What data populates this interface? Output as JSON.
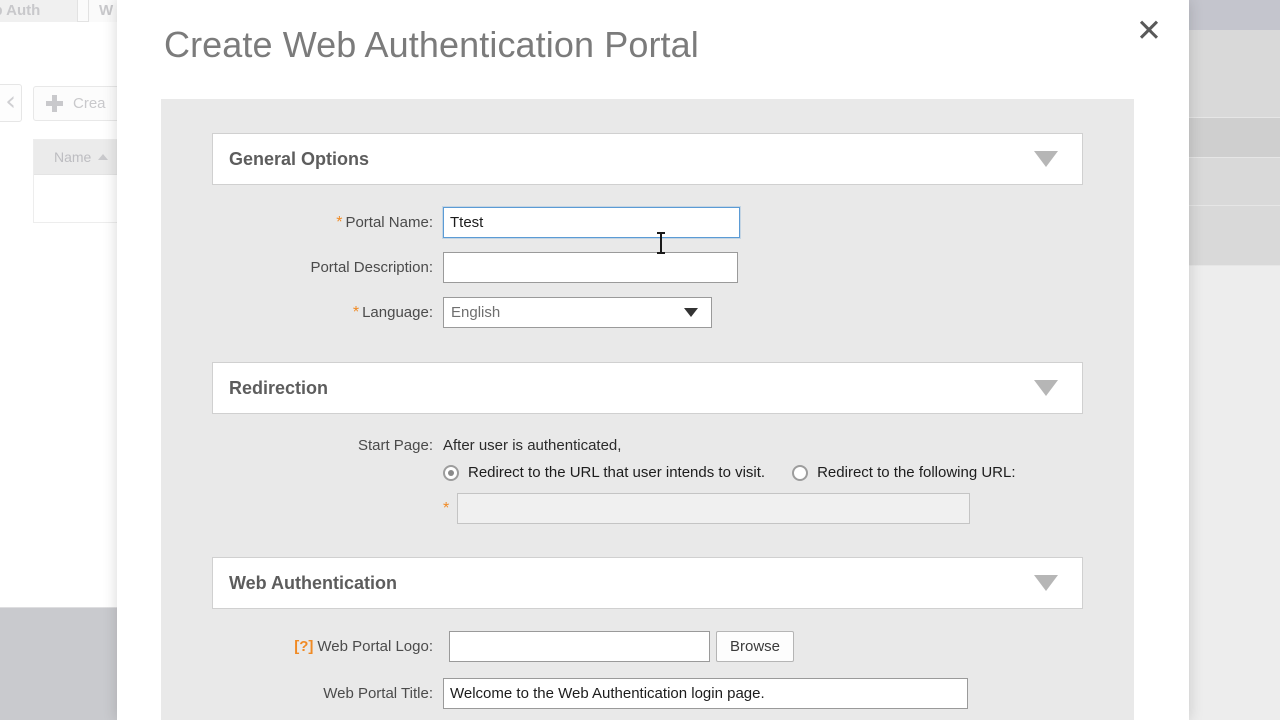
{
  "background": {
    "tabs": [
      {
        "label": "eb Auth"
      },
      {
        "label": "W"
      }
    ],
    "back_chevron": "‹",
    "create_button": {
      "label": "Crea",
      "icon": "plus-icon"
    },
    "table": {
      "columns": [
        "Name"
      ]
    }
  },
  "modal": {
    "title": "Create Web Authentication Portal",
    "close_label": "✕",
    "sections": [
      {
        "id": "general_options",
        "title": "General Options",
        "caret": "chevron-down-icon"
      },
      {
        "id": "redirection",
        "title": "Redirection",
        "caret": "chevron-down-icon"
      },
      {
        "id": "web_authentication",
        "title": "Web Authentication",
        "caret": "chevron-down-icon"
      }
    ],
    "general_options": {
      "portal_name": {
        "label": "Portal Name:",
        "required": true,
        "required_marker": "*",
        "value": "Ttest",
        "placeholder": ""
      },
      "portal_description": {
        "label": "Portal Description:",
        "required": false,
        "value": "",
        "placeholder": ""
      },
      "language": {
        "label": "Language:",
        "required": true,
        "required_marker": "*",
        "value": "English",
        "options": [
          "English"
        ]
      }
    },
    "redirection": {
      "start_page": {
        "label": "Start Page:",
        "intro": "After user is authenticated,",
        "options": [
          {
            "label": "Redirect to the URL that user intends to visit.",
            "selected": true
          },
          {
            "label": "Redirect to the following URL:",
            "selected": false
          }
        ],
        "url_field": {
          "required_marker": "*",
          "value": "",
          "placeholder": "",
          "disabled": true
        }
      }
    },
    "web_authentication": {
      "web_portal_logo": {
        "help_marker": "[?]",
        "label": "Web Portal Logo:",
        "value": "",
        "placeholder": "",
        "browse_label": "Browse"
      },
      "web_portal_title": {
        "label": "Web Portal Title:",
        "value": "Welcome to the Web Authentication login page.",
        "placeholder": ""
      }
    }
  },
  "colors": {
    "accent_required": "#f08a24",
    "title_gray": "#7b7b7b",
    "modal_body": "#e9e9e9",
    "focus_blue": "#5b9bd5"
  }
}
